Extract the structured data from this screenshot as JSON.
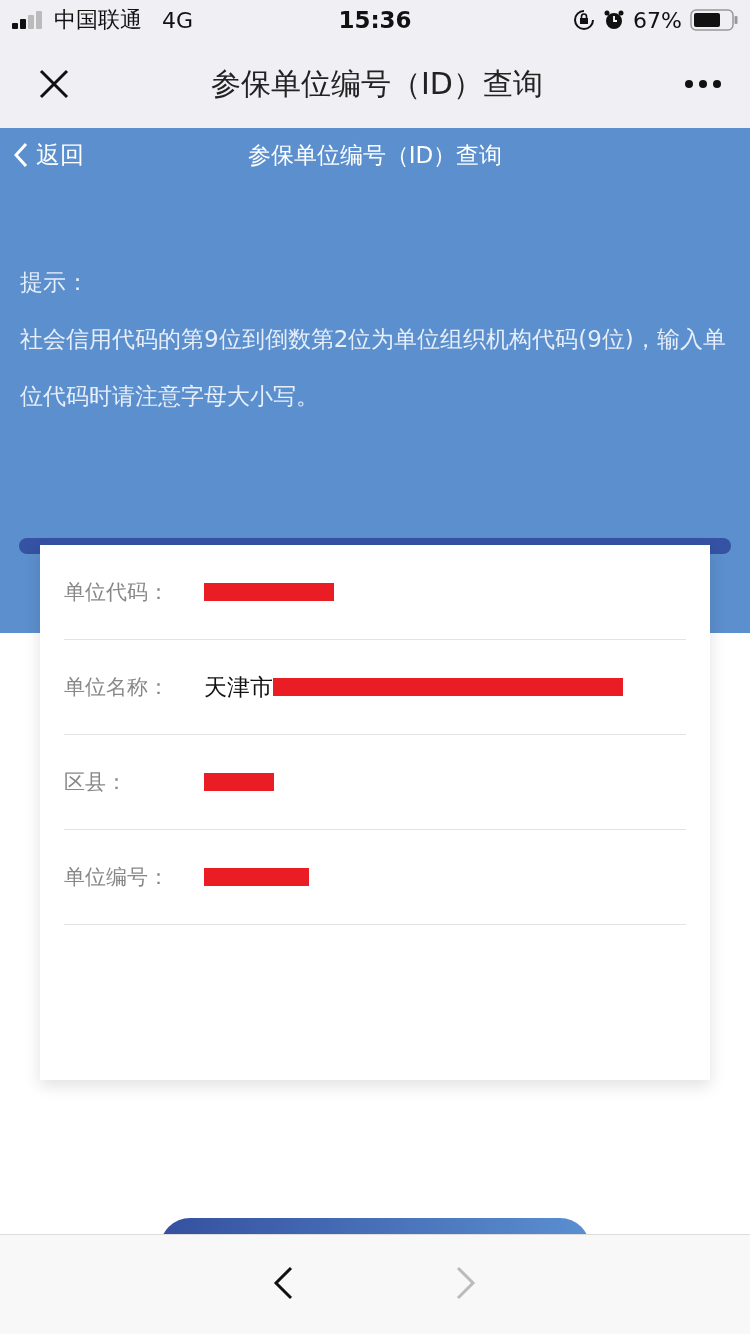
{
  "status_bar": {
    "carrier": "中国联通",
    "network": "4G",
    "time": "15:36",
    "battery": "67%"
  },
  "nav_bar": {
    "title": "参保单位编号（ID）查询"
  },
  "header": {
    "back": "返回",
    "title": "参保单位编号（ID）查询",
    "hint_label": "提示：",
    "hint_text": "社会信用代码的第9位到倒数第2位为单位组织机构代码(9位)，输入单位代码时请注意字母大小写。"
  },
  "fields": [
    {
      "label": "单位代码：",
      "redacted": true
    },
    {
      "label": "单位名称：",
      "value": "天津市",
      "redacted": true
    },
    {
      "label": "区县：",
      "redacted": true
    },
    {
      "label": "单位编号：",
      "redacted": true
    }
  ],
  "toolbar": [
    {
      "kind": "back",
      "disabled": false
    },
    {
      "kind": "forward",
      "disabled": true
    }
  ]
}
